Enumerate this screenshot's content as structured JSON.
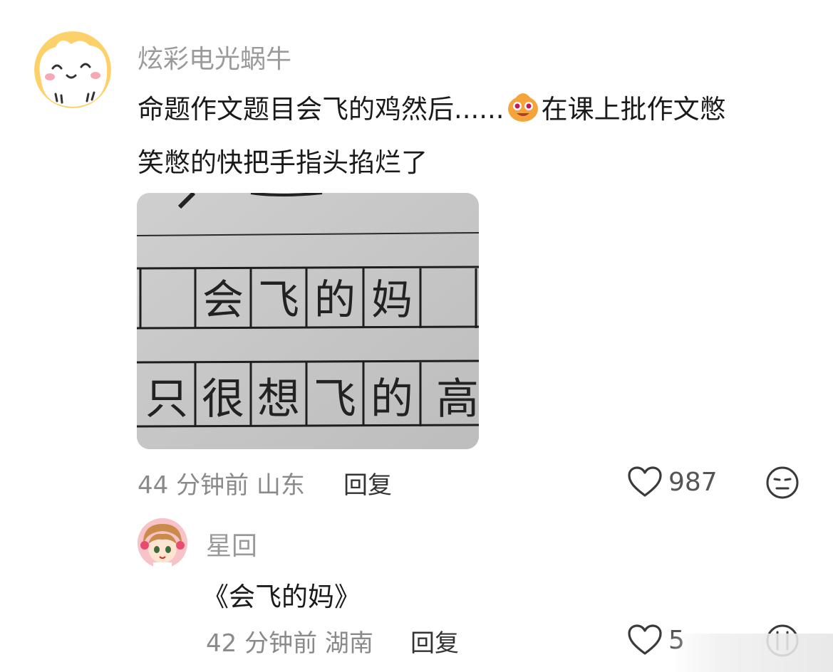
{
  "comment": {
    "username": "炫彩电光蜗牛",
    "text_line1_before_emoji": "命题作文题目会飞的鸡然后......",
    "emoji": "smug-face-emoji",
    "text_line1_after_emoji": "在课上批作文憋",
    "text_line2": "笑憋的快把手指头掐烂了",
    "photo": {
      "row1_chars": [
        "会",
        "飞",
        "的",
        "妈"
      ],
      "row2_chars": [
        "只",
        "很",
        "想",
        "飞",
        "的",
        "高"
      ]
    },
    "time": "44 分钟前",
    "location": "山东",
    "reply_label": "回复",
    "like_count": "987",
    "react_icon": "meh-face-icon",
    "like_icon": "heart-outline-icon"
  },
  "reply": {
    "username": "星回",
    "text": "《会飞的妈》",
    "time": "42 分钟前",
    "location": "湖南",
    "reply_label": "回复",
    "like_count_partial": "5",
    "react_icon": "crying-face-icon",
    "like_icon": "heart-outline-icon"
  },
  "colors": {
    "username": "#9a9a9a",
    "text": "#1a1a1a",
    "meta": "#8a8a8a",
    "icon": "#3a3a3a"
  }
}
